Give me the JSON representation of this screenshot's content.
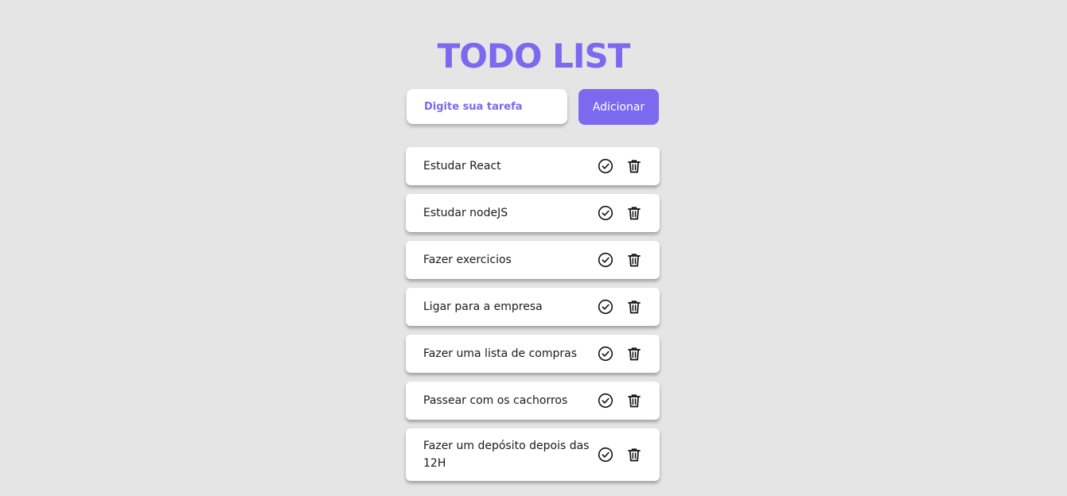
{
  "header": {
    "title": "TODO LIST"
  },
  "form": {
    "placeholder": "Digite sua tarefa",
    "value": "",
    "add_label": "Adicionar"
  },
  "tasks": [
    {
      "text": "Estudar React",
      "icons": [
        "check-circle-icon",
        "trash-icon"
      ]
    },
    {
      "text": "Estudar nodeJS",
      "icons": [
        "check-circle-icon",
        "trash-icon"
      ]
    },
    {
      "text": "Fazer exercicios",
      "icons": [
        "check-circle-icon",
        "trash-icon"
      ]
    },
    {
      "text": "Ligar para a empresa",
      "icons": [
        "check-circle-icon",
        "trash-icon"
      ]
    },
    {
      "text": "Fazer uma lista de compras",
      "icons": [
        "check-circle-icon",
        "trash-icon"
      ]
    },
    {
      "text": "Passear com os cachorros",
      "icons": [
        "check-circle-icon",
        "trash-icon"
      ]
    },
    {
      "text": "Fazer um depósito depois das 12H",
      "icons": [
        "check-circle-icon",
        "trash-icon"
      ]
    }
  ],
  "colors": {
    "accent": "#7b69ef",
    "background": "#e5e5e5",
    "card": "#ffffff"
  }
}
